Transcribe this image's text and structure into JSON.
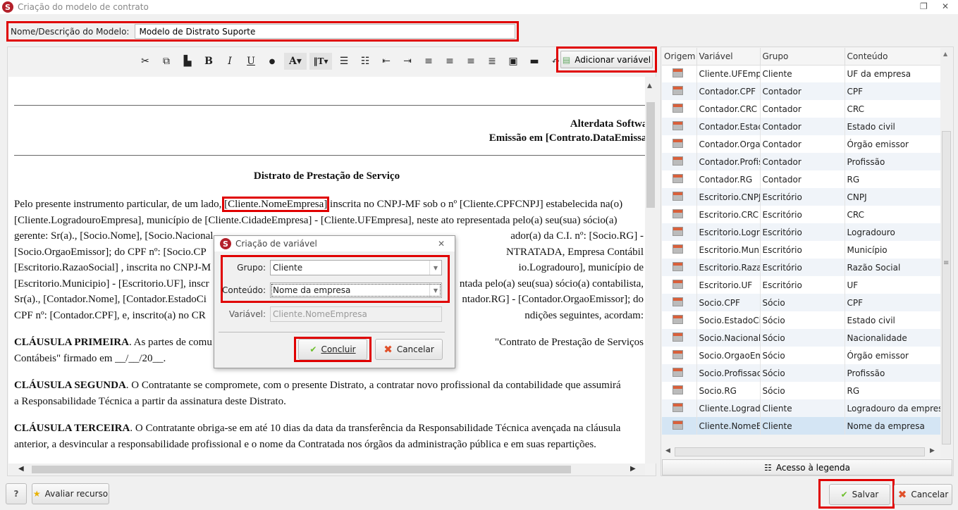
{
  "window": {
    "title": "Criação do modelo de contrato",
    "logo": "S"
  },
  "name_field": {
    "label": "Nome/Descrição do Modelo:",
    "value": "Modelo de Distrato Suporte"
  },
  "toolbar": {
    "icons": [
      "scissors-icon",
      "copy-icon",
      "paste-icon",
      "bold-icon",
      "italic-icon",
      "underline-icon",
      "color-drop-icon",
      "font-color-icon",
      "font-size-icon",
      "ordered-list-icon",
      "unordered-list-icon",
      "outdent-icon",
      "indent-icon",
      "align-left-icon",
      "align-center-icon",
      "align-right-icon",
      "justify-icon",
      "image-icon",
      "horizontal-rule-icon",
      "undo-icon"
    ],
    "glyphs": {
      "cut": "✂",
      "copy": "⧉",
      "paste": "▙",
      "bold": "B",
      "italic": "I",
      "underline": "U",
      "drop": "●",
      "fontcolor": "A▾",
      "fontsize": "‖T▾",
      "ol": "☰",
      "ul": "☷",
      "outdent": "⇤",
      "indent": "⇥",
      "left": "≡",
      "center": "≡",
      "right": "≡",
      "justify": "≣",
      "image": "▣",
      "hr": "▬",
      "undo": "↶"
    },
    "add_variable": "Adicionar variável"
  },
  "document": {
    "header_line1": "Alterdata Softwar",
    "header_line2": "Emissão em [Contrato.DataEmissao",
    "title": "Distrato de Prestação de Serviço",
    "p1": {
      "l1a": "Pelo presente instrumento particular, de um lado, ",
      "l1hl": "[Cliente.NomeEmpresa]",
      "l1b": " inscrita no CNPJ-MF sob o nº [Cliente.CPFCNPJ] estabelecida na(o)",
      "lines": [
        [
          "[Cliente.LogradouroEmpresa],  município de [Cliente.CidadeEmpresa] - [Cliente.UFEmpresa], neste ato representada pelo(a) seu(sua) sócio(a)",
          ""
        ],
        [
          "gerente: Sr(a)., [Socio.Nome], [Socio.Nacional",
          "ador(a) da C.I. nº: [Socio.RG] -"
        ],
        [
          "[Socio.OrgaoEmissor];  do CPF nº: [Socio.CP",
          "NTRATADA, Empresa Contábil"
        ],
        [
          "[Escritorio.RazaoSocial] , inscrita no CNPJ-M",
          "io.Logradouro], município de"
        ],
        [
          "[Escritorio.Municipio] - [Escritorio.UF], inscr",
          "ntada pelo(a) seu(sua) sócio(a) contabilista,"
        ],
        [
          "Sr(a)., [Contador.Nome], [Contador.EstadoCi",
          "ntador.RG] - [Contador.OrgaoEmissor]; do"
        ],
        [
          "CPF nº: [Contador.CPF], e, inscrito(a) no CR",
          "ndições seguintes, acordam:"
        ]
      ]
    },
    "p2": {
      "bold": "CLÁUSULA PRIMEIRA",
      "l1a": ". As partes de comu",
      "l1b": "\"Contrato de Prestação de Serviços",
      "l2": "Contábeis\" firmado em __/__/20__."
    },
    "p3": {
      "bold": "CLÁUSULA SEGUNDA",
      "l1": ". O Contratante se compromete, com o presente Distrato, a contratar novo profissional da contabilidade que assumirá",
      "l2": "a Responsabilidade Técnica a partir da assinatura deste Distrato."
    },
    "p4": {
      "bold": "CLÁUSULA TERCEIRA",
      "l1": ". O Contratante obriga-se em até 10 dias da data da transferência da Responsabilidade Técnica avençada na cláusula",
      "l2": "anterior, a desvincular a responsabilidade profissional e o nome da Contratada nos órgãos da administração pública e em suas repartições."
    }
  },
  "variables_table": {
    "headers": [
      "Origem",
      "Variável",
      "Grupo",
      "Conteúdo"
    ],
    "rows": [
      [
        "Cliente.UFEmpr",
        "Cliente",
        "UF da empresa"
      ],
      [
        "Contador.CPF",
        "Contador",
        "CPF"
      ],
      [
        "Contador.CRC",
        "Contador",
        "CRC"
      ],
      [
        "Contador.Estad",
        "Contador",
        "Estado civil"
      ],
      [
        "Contador.Orga",
        "Contador",
        "Órgão emissor"
      ],
      [
        "Contador.Profis",
        "Contador",
        "Profissão"
      ],
      [
        "Contador.RG",
        "Contador",
        "RG"
      ],
      [
        "Escritorio.CNPJ",
        "Escritório",
        "CNPJ"
      ],
      [
        "Escritorio.CRC",
        "Escritório",
        "CRC"
      ],
      [
        "Escritorio.Logra",
        "Escritório",
        "Logradouro"
      ],
      [
        "Escritorio.Muni",
        "Escritório",
        "Município"
      ],
      [
        "Escritorio.Razao",
        "Escritório",
        "Razão Social"
      ],
      [
        "Escritorio.UF",
        "Escritório",
        "UF"
      ],
      [
        "Socio.CPF",
        "Sócio",
        "CPF"
      ],
      [
        "Socio.EstadoCiv",
        "Sócio",
        "Estado civil"
      ],
      [
        "Socio.Nacionali",
        "Sócio",
        "Nacionalidade"
      ],
      [
        "Socio.OrgaoEmi",
        "Sócio",
        "Órgão emissor"
      ],
      [
        "Socio.Profissao",
        "Sócio",
        "Profissão"
      ],
      [
        "Socio.RG",
        "Sócio",
        "RG"
      ],
      [
        "Cliente.Logrado",
        "Cliente",
        "Logradouro da empresa"
      ],
      [
        "Cliente.NomeE",
        "Cliente",
        "Nome da empresa"
      ]
    ],
    "selected_index": 20,
    "legend_button": "Acesso à legenda"
  },
  "dialog": {
    "title": "Criação de variável",
    "grupo_label": "Grupo:",
    "grupo_value": "Cliente",
    "conteudo_label": "Conteúdo:",
    "conteudo_value": "Nome da empresa",
    "variavel_label": "Variável:",
    "variavel_value": "Cliente.NomeEmpresa",
    "confirm": "Concluir",
    "cancel": "Cancelar"
  },
  "footer": {
    "help": "?",
    "rate": "Avaliar recurso",
    "save": "Salvar",
    "cancel": "Cancelar"
  },
  "colors": {
    "highlight": "#e00000",
    "selected_row": "#d4e5f4",
    "brand": "#b3202a"
  }
}
